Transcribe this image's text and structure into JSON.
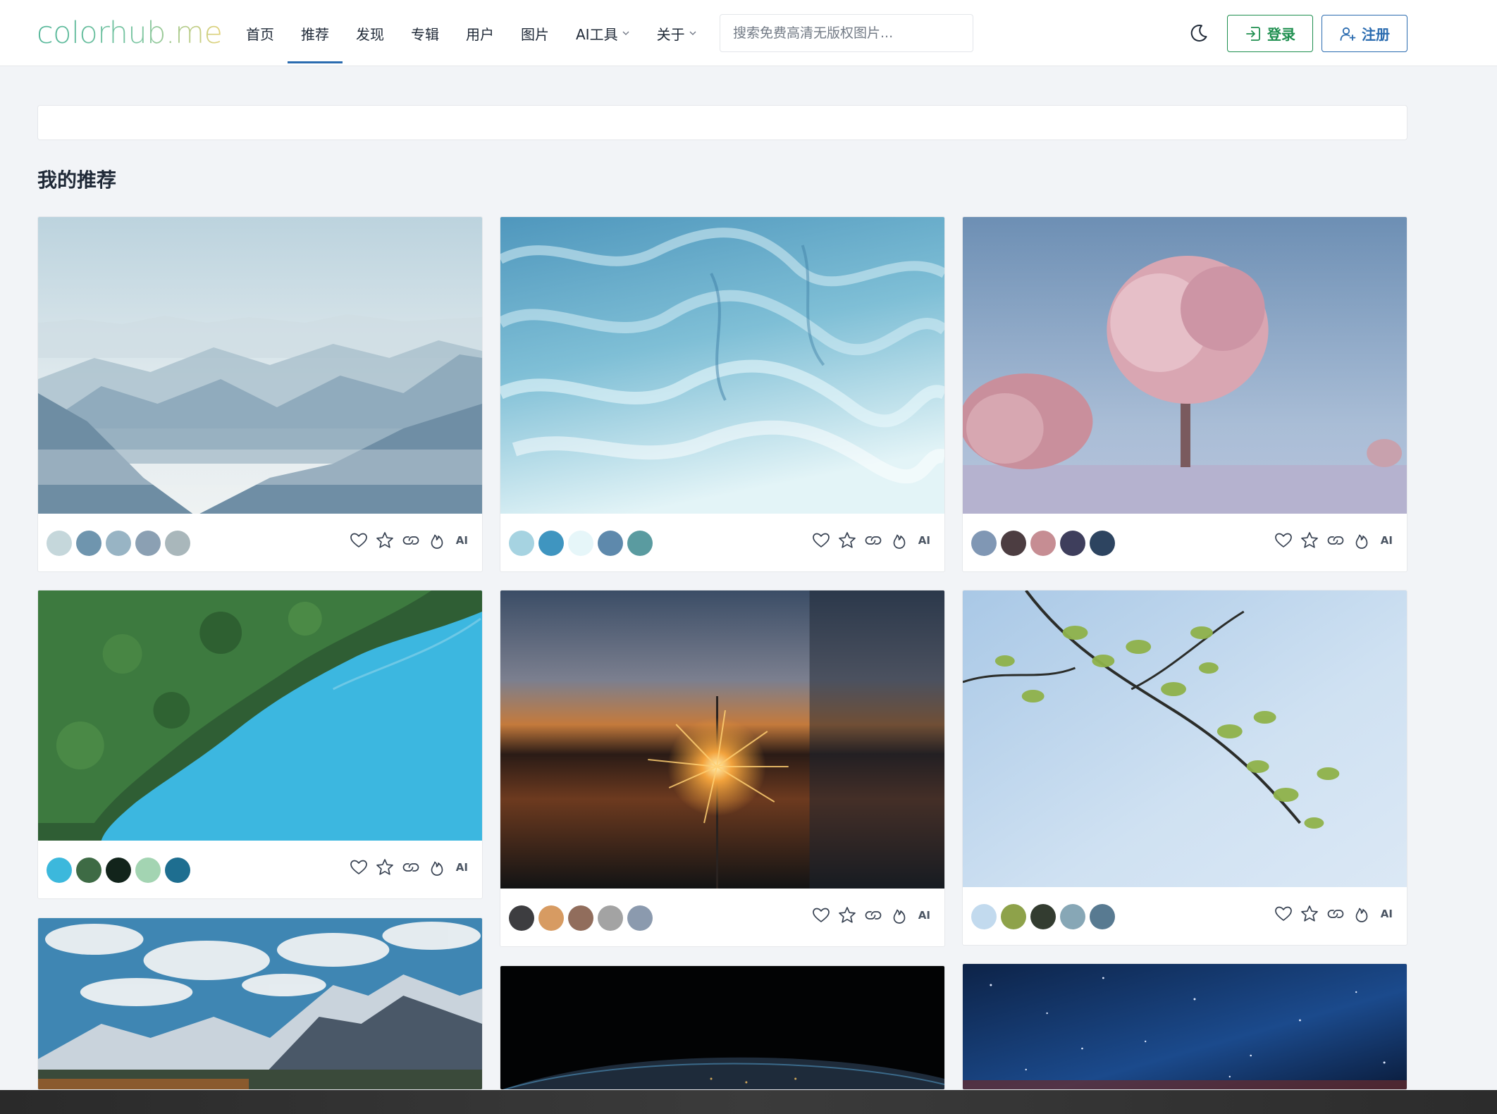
{
  "site": {
    "logo": "colorhub.me"
  },
  "nav": {
    "items": [
      {
        "label": "首页"
      },
      {
        "label": "推荐"
      },
      {
        "label": "发现"
      },
      {
        "label": "专辑"
      },
      {
        "label": "用户"
      },
      {
        "label": "图片"
      },
      {
        "label": "AI工具"
      },
      {
        "label": "关于"
      }
    ],
    "active": "推荐"
  },
  "search": {
    "placeholder": "搜索免费高清无版权图片..."
  },
  "auth": {
    "login_label": "登录",
    "register_label": "注册"
  },
  "colors": {
    "accent_blue": "#2b6cb0",
    "accent_green": "#1e8f4f"
  },
  "main": {
    "section_title": "我的推荐",
    "cards": [
      {
        "subject": "misty mountains",
        "swatches": [
          "#c5d7db",
          "#6f95ae",
          "#98b4c4",
          "#8ba0b3",
          "#a9b7bb"
        ],
        "ai_label": "AI"
      },
      {
        "subject": "rippled water",
        "swatches": [
          "#a6d3e1",
          "#3f95c0",
          "#e6f6f9",
          "#5e89ac",
          "#5a9ba0"
        ],
        "ai_label": "AI"
      },
      {
        "subject": "frosted pink tree",
        "swatches": [
          "#8097b4",
          "#4c3d41",
          "#c68d93",
          "#3e3e5c",
          "#2d4460"
        ],
        "ai_label": "AI"
      },
      {
        "subject": "forest and turquoise lake aerial",
        "swatches": [
          "#3cb8dc",
          "#3e6b45",
          "#12241b",
          "#a3d4b2",
          "#1e6e90"
        ],
        "ai_label": "AI"
      },
      {
        "subject": "sparkler at sunset",
        "swatches": [
          "#3d3d40",
          "#d79b62",
          "#916d5c",
          "#a3a3a3",
          "#8b9aae"
        ],
        "ai_label": "AI"
      },
      {
        "subject": "green leaves branch against sky",
        "swatches": [
          "#c2daee",
          "#8ea24a",
          "#333c30",
          "#87a7b6",
          "#587a91"
        ],
        "ai_label": "AI"
      },
      {
        "subject": "snowy mountain range with clouds"
      },
      {
        "subject": "earth from space at night"
      },
      {
        "subject": "starry night sky"
      }
    ]
  }
}
